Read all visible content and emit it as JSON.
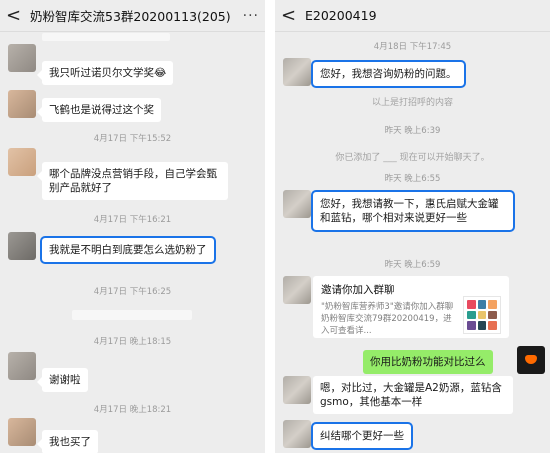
{
  "left": {
    "title": "奶粉智库交流53群20200113(205)",
    "back": "<",
    "more": "···",
    "timestamps": [
      "4月17日 下午15:52",
      "4月17日 下午16:21",
      "4月17日 下午16:25",
      "4月17日 晚上18:15",
      "4月17日 晚上18:21"
    ],
    "messages": [
      "我只听过诺贝尔文学奖😂",
      "飞鹤也是说得过这个奖",
      "哪个品牌没点营销手段，自己学会甄别产品就好了",
      "我就是不明白到底要怎么选奶粉了",
      "谢谢啦",
      "我也买了"
    ]
  },
  "right": {
    "title": "E20200419",
    "back": "<",
    "timestamps": [
      "4月18日 下午17:45",
      "昨天 晚上6:39",
      "昨天 晚上6:55",
      "昨天 晚上6:59"
    ],
    "system": [
      "以上是打招呼的内容",
      "你已添加了 ___ 现在可以开始聊天了。"
    ],
    "messages": [
      "您好，我想咨询奶粉的问题。",
      "您好，我想请教一下，惠氏启赋大金罐和蓝钻，哪个相对来说更好一些",
      "你用比奶粉功能对比过么",
      "嗯，对比过，大金罐是A2奶源，蓝钻含gsmo，其他基本一样",
      "纠结哪个更好一些"
    ],
    "card": {
      "title": "邀请你加入群聊",
      "desc": "\"奶粉智库营养师3\"邀请你加入群聊奶粉智库交流79群20200419，进入可查看详..."
    }
  },
  "colors": {
    "highlight": "#1a73e8",
    "green_bubble": "#95ec69",
    "background": "#ededed"
  }
}
